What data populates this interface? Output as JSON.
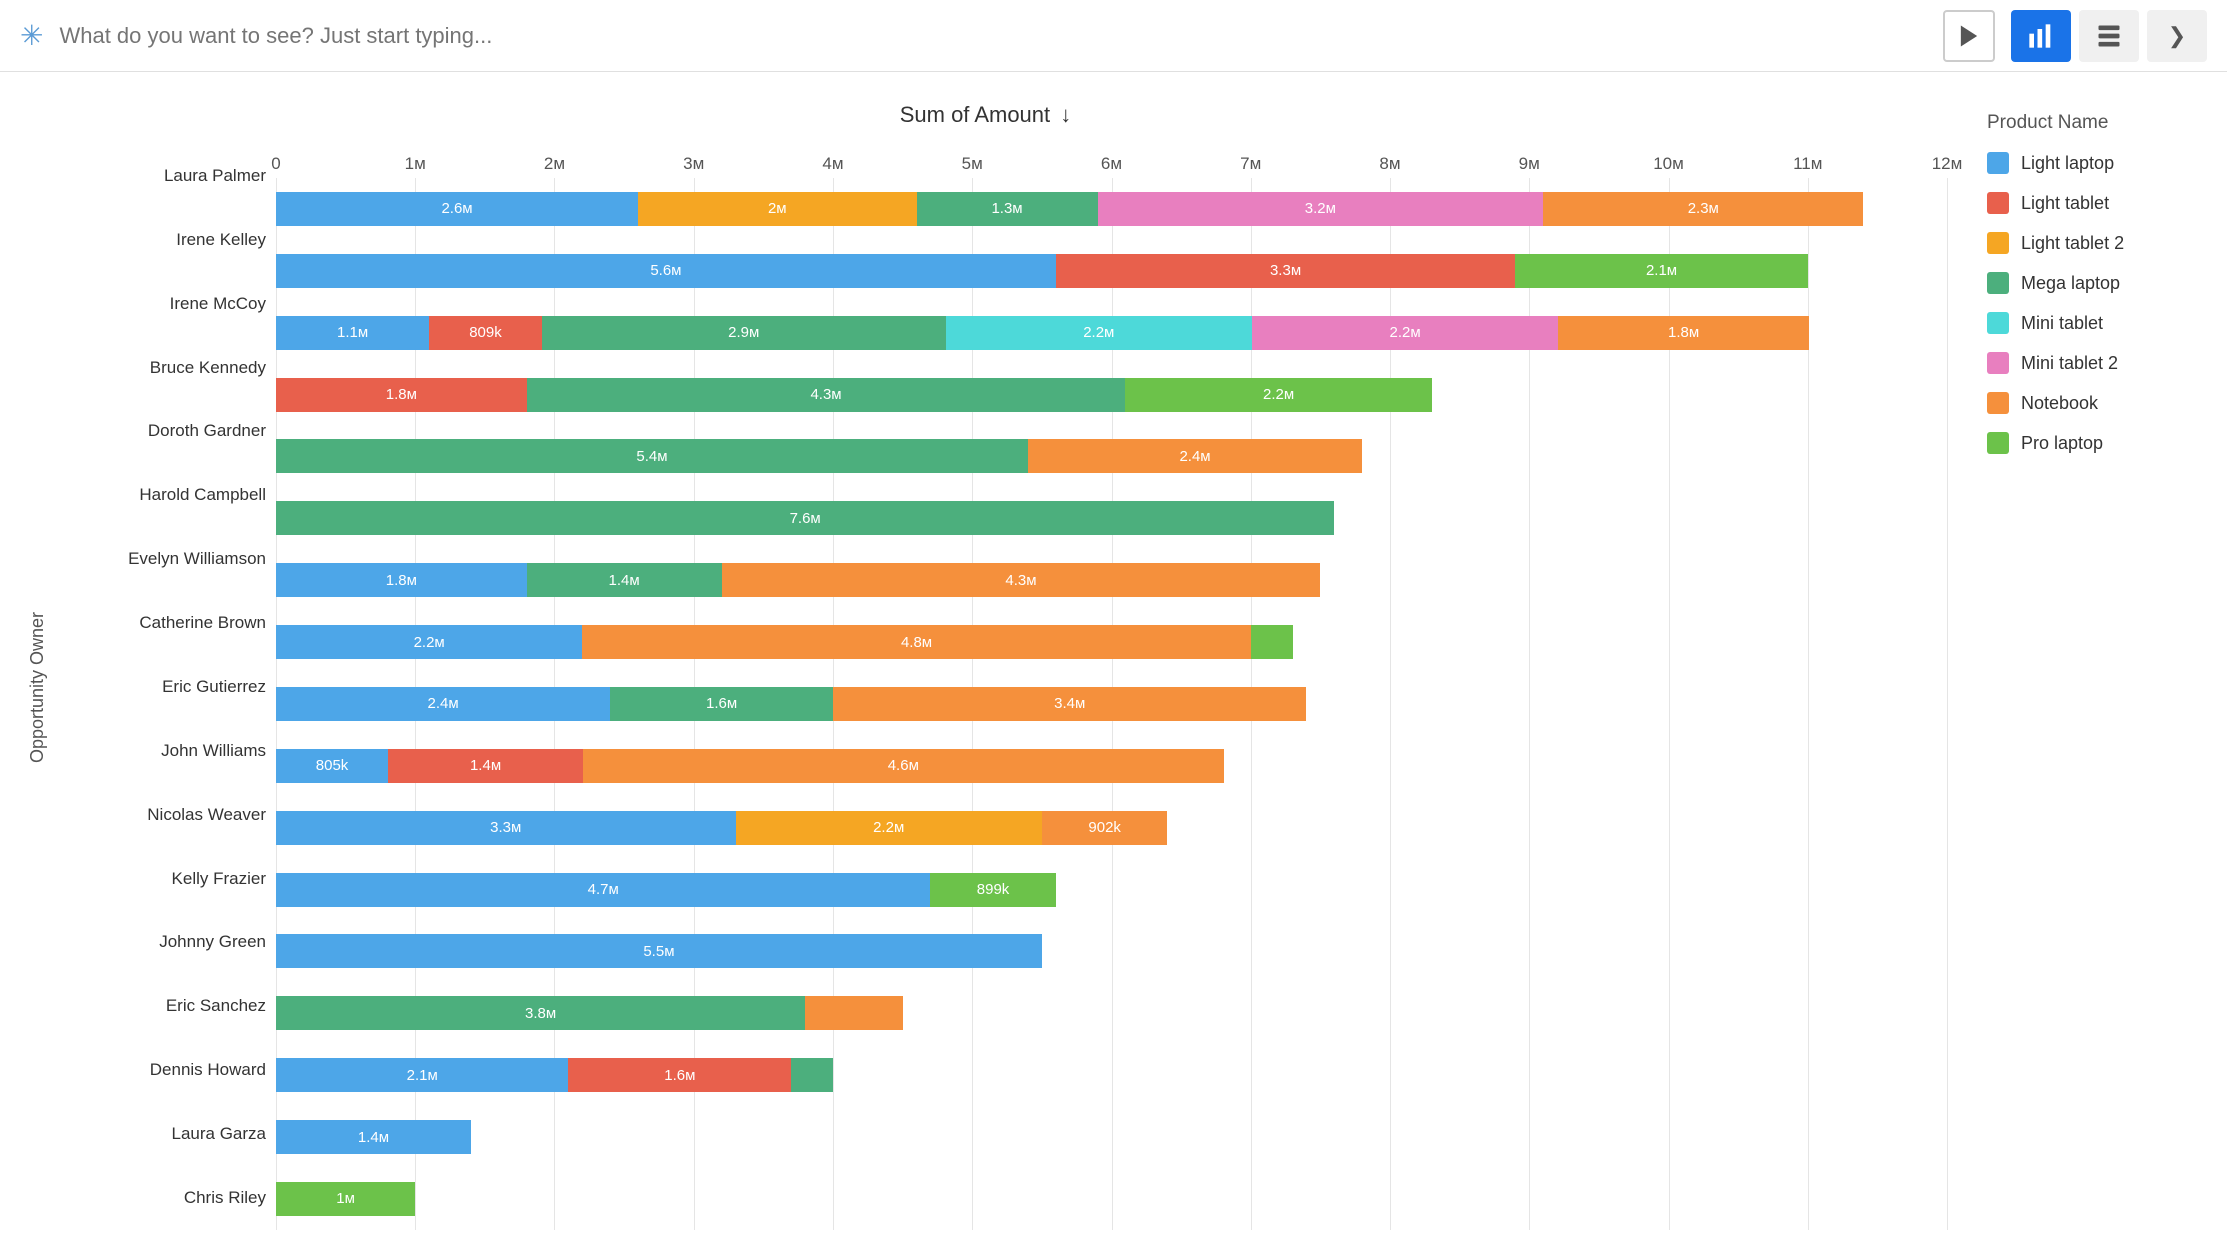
{
  "header": {
    "search_placeholder": "What do you want to see? Just start typing...",
    "btn_chart_label": "chart-icon",
    "btn_table_label": "table-icon",
    "btn_terminal_label": "terminal-icon"
  },
  "chart": {
    "title": "Sum of Amount",
    "title_arrow": "↓",
    "y_axis_label": "Opportunity Owner",
    "x_ticks": [
      "0",
      "1м",
      "2м",
      "3м",
      "4м",
      "5м",
      "6м",
      "7м",
      "8м",
      "9м",
      "10м",
      "11м",
      "12м"
    ],
    "max_value": 12000000,
    "colors": {
      "Light laptop": "#4da6e8",
      "Light tablet": "#e8604c",
      "Light tablet 2": "#f5a623",
      "Mega laptop": "#4caf7d",
      "Mini tablet": "#4dd9d9",
      "Mini tablet 2": "#e87fbf",
      "Notebook": "#f5903c",
      "Pro laptop": "#6cc24a"
    },
    "rows": [
      {
        "name": "Laura Palmer",
        "segments": [
          {
            "product": "Light laptop",
            "value": 2600000,
            "label": "2.6м"
          },
          {
            "product": "Light tablet 2",
            "value": 2000000,
            "label": "2м"
          },
          {
            "product": "Mega laptop",
            "value": 1300000,
            "label": "1.3м"
          },
          {
            "product": "Mini tablet 2",
            "value": 3200000,
            "label": "3.2м"
          },
          {
            "product": "Notebook",
            "value": 2300000,
            "label": "2.3м"
          }
        ]
      },
      {
        "name": "Irene Kelley",
        "segments": [
          {
            "product": "Light laptop",
            "value": 5600000,
            "label": "5.6м"
          },
          {
            "product": "Light tablet",
            "value": 3300000,
            "label": "3.3м"
          },
          {
            "product": "Pro laptop",
            "value": 2100000,
            "label": "2.1м"
          }
        ]
      },
      {
        "name": "Irene McCoy",
        "segments": [
          {
            "product": "Light laptop",
            "value": 1100000,
            "label": "1.1м"
          },
          {
            "product": "Light tablet",
            "value": 809000,
            "label": "809k"
          },
          {
            "product": "Mega laptop",
            "value": 2900000,
            "label": "2.9м"
          },
          {
            "product": "Mini tablet",
            "value": 2200000,
            "label": "2.2м"
          },
          {
            "product": "Mini tablet 2",
            "value": 2200000,
            "label": "2.2м"
          },
          {
            "product": "Notebook",
            "value": 1800000,
            "label": "1.8м"
          }
        ]
      },
      {
        "name": "Bruce Kennedy",
        "segments": [
          {
            "product": "Light tablet",
            "value": 1800000,
            "label": "1.8м"
          },
          {
            "product": "Mega laptop",
            "value": 4300000,
            "label": "4.3м"
          },
          {
            "product": "Pro laptop",
            "value": 2200000,
            "label": "2.2м"
          }
        ]
      },
      {
        "name": "Doroth Gardner",
        "segments": [
          {
            "product": "Mega laptop",
            "value": 5400000,
            "label": "5.4м"
          },
          {
            "product": "Notebook",
            "value": 2400000,
            "label": "2.4м"
          }
        ]
      },
      {
        "name": "Harold Campbell",
        "segments": [
          {
            "product": "Mega laptop",
            "value": 7600000,
            "label": "7.6м"
          }
        ]
      },
      {
        "name": "Evelyn Williamson",
        "segments": [
          {
            "product": "Light laptop",
            "value": 1800000,
            "label": "1.8м"
          },
          {
            "product": "Mega laptop",
            "value": 1400000,
            "label": "1.4м"
          },
          {
            "product": "Notebook",
            "value": 4300000,
            "label": "4.3м"
          }
        ]
      },
      {
        "name": "Catherine Brown",
        "segments": [
          {
            "product": "Light laptop",
            "value": 2200000,
            "label": "2.2м"
          },
          {
            "product": "Notebook",
            "value": 4800000,
            "label": "4.8м"
          },
          {
            "product": "Pro laptop",
            "value": 300000,
            "label": ""
          }
        ]
      },
      {
        "name": "Eric Gutierrez",
        "segments": [
          {
            "product": "Light laptop",
            "value": 2400000,
            "label": "2.4м"
          },
          {
            "product": "Mega laptop",
            "value": 1600000,
            "label": "1.6м"
          },
          {
            "product": "Notebook",
            "value": 3400000,
            "label": "3.4м"
          }
        ]
      },
      {
        "name": "John Williams",
        "segments": [
          {
            "product": "Light laptop",
            "value": 805000,
            "label": "805k"
          },
          {
            "product": "Light tablet",
            "value": 1400000,
            "label": "1.4м"
          },
          {
            "product": "Notebook",
            "value": 4600000,
            "label": "4.6м"
          }
        ]
      },
      {
        "name": "Nicolas Weaver",
        "segments": [
          {
            "product": "Light laptop",
            "value": 3300000,
            "label": "3.3м"
          },
          {
            "product": "Light tablet 2",
            "value": 2200000,
            "label": "2.2м"
          },
          {
            "product": "Notebook",
            "value": 902000,
            "label": "902k"
          }
        ]
      },
      {
        "name": "Kelly Frazier",
        "segments": [
          {
            "product": "Light laptop",
            "value": 4700000,
            "label": "4.7м"
          },
          {
            "product": "Pro laptop",
            "value": 899000,
            "label": "899k"
          }
        ]
      },
      {
        "name": "Johnny Green",
        "segments": [
          {
            "product": "Light laptop",
            "value": 5500000,
            "label": "5.5м"
          }
        ]
      },
      {
        "name": "Eric Sanchez",
        "segments": [
          {
            "product": "Mega laptop",
            "value": 3800000,
            "label": "3.8м"
          },
          {
            "product": "Notebook",
            "value": 700000,
            "label": ""
          }
        ]
      },
      {
        "name": "Dennis Howard",
        "segments": [
          {
            "product": "Light laptop",
            "value": 2100000,
            "label": "2.1м"
          },
          {
            "product": "Light tablet",
            "value": 1600000,
            "label": "1.6м"
          },
          {
            "product": "Mega laptop",
            "value": 300000,
            "label": ""
          }
        ]
      },
      {
        "name": "Laura Garza",
        "segments": [
          {
            "product": "Light laptop",
            "value": 1400000,
            "label": "1.4м"
          }
        ]
      },
      {
        "name": "Chris Riley",
        "segments": [
          {
            "product": "Pro laptop",
            "value": 1000000,
            "label": "1м"
          }
        ]
      }
    ],
    "legend_title": "Product Name",
    "legend_items": [
      {
        "label": "Light laptop",
        "color_key": "Light laptop"
      },
      {
        "label": "Light tablet",
        "color_key": "Light tablet"
      },
      {
        "label": "Light tablet 2",
        "color_key": "Light tablet 2"
      },
      {
        "label": "Mega laptop",
        "color_key": "Mega laptop"
      },
      {
        "label": "Mini tablet",
        "color_key": "Mini tablet"
      },
      {
        "label": "Mini tablet 2",
        "color_key": "Mini tablet 2"
      },
      {
        "label": "Notebook",
        "color_key": "Notebook"
      },
      {
        "label": "Pro laptop",
        "color_key": "Pro laptop"
      }
    ]
  }
}
